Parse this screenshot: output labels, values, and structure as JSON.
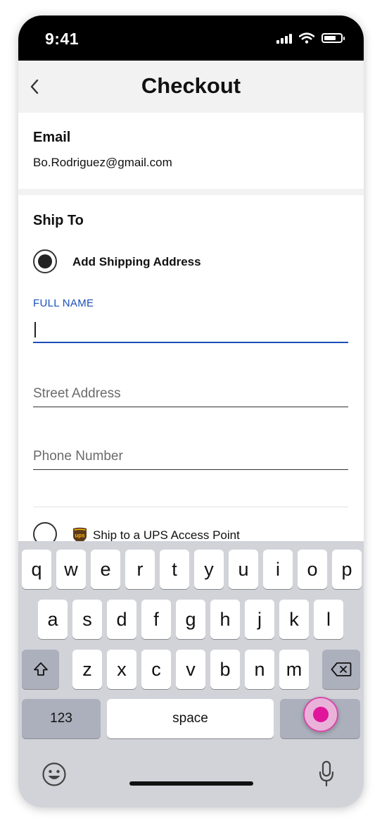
{
  "status_bar": {
    "time": "9:41"
  },
  "nav": {
    "title": "Checkout"
  },
  "email": {
    "label": "Email",
    "value": "Bo.Rodriguez@gmail.com"
  },
  "ship_to": {
    "label": "Ship To",
    "add_address_label": "Add Shipping Address",
    "full_name_label": "FULL NAME",
    "full_name_value": "",
    "street_placeholder": "Street Address",
    "phone_placeholder": "Phone Number",
    "ups_label": "Ship to a UPS Access Point",
    "ups_logo_text": "ups"
  },
  "keyboard": {
    "row1": [
      "q",
      "w",
      "e",
      "r",
      "t",
      "y",
      "u",
      "i",
      "o",
      "p"
    ],
    "row2": [
      "a",
      "s",
      "d",
      "f",
      "g",
      "h",
      "j",
      "k",
      "l"
    ],
    "row3": [
      "z",
      "x",
      "c",
      "v",
      "b",
      "n",
      "m"
    ],
    "numbers_label": "123",
    "space_label": "space"
  },
  "colors": {
    "accent_blue": "#1a4fb8",
    "touch_pink": "#e0169b",
    "ups_brown": "#5b3a1c",
    "ups_gold": "#ffb500"
  }
}
